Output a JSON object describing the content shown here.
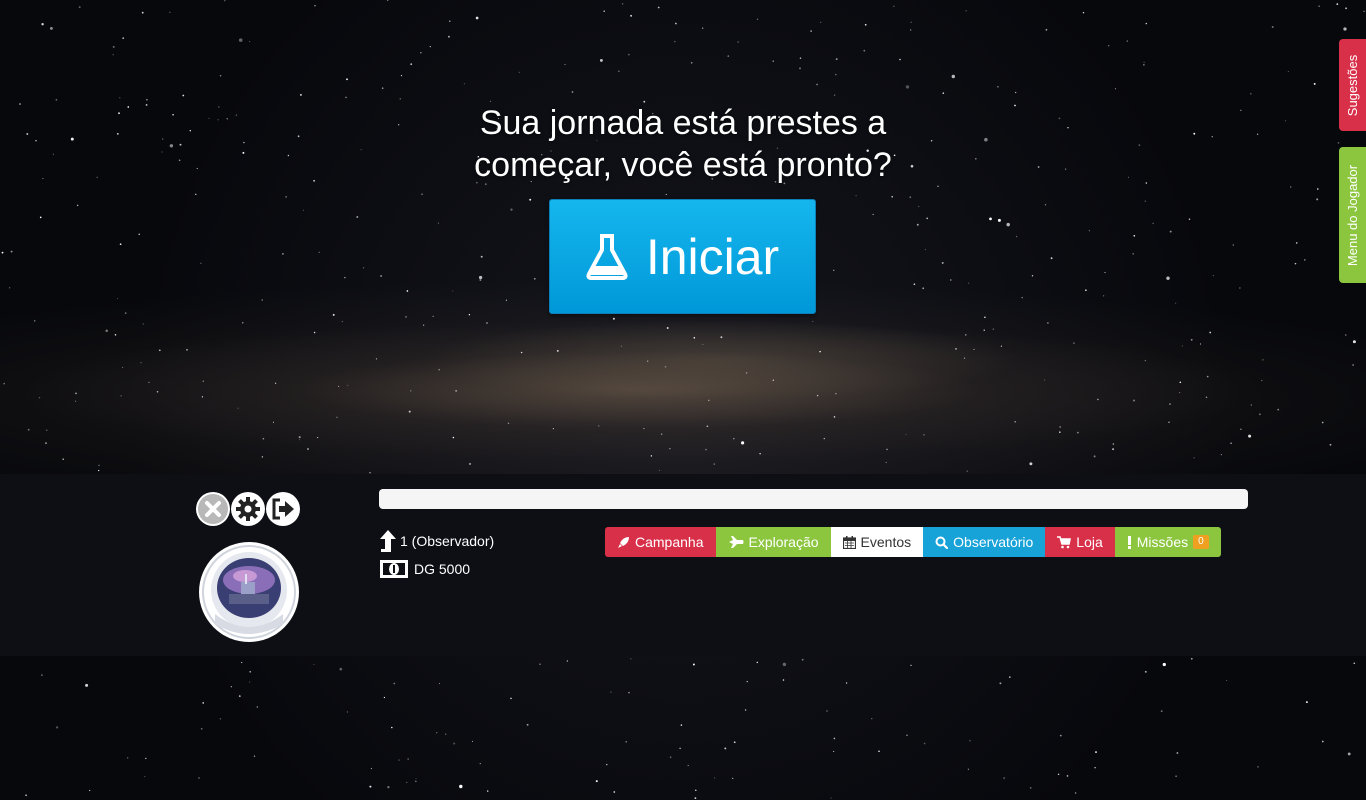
{
  "hero": {
    "headline_line1": "Sua jornada está prestes a",
    "headline_line2": "começar, você está pronto?",
    "start_label": "Iniciar"
  },
  "side_tabs": {
    "suggestions": "Sugestões",
    "player_menu": "Menu do Jogador"
  },
  "player": {
    "level": "1 (Observador)",
    "currency": "DG 5000",
    "progress": 0
  },
  "nav": {
    "campaign": "Campanha",
    "exploration": "Exploração",
    "events": "Eventos",
    "observatory": "Observatório",
    "shop": "Loja",
    "missions": "Missões",
    "missions_badge": "0"
  },
  "colors": {
    "red": "#d9304a",
    "green": "#8cc63f",
    "blue": "#17a2d8",
    "start_button": "#0aa6e4",
    "badge": "#f0a020"
  },
  "icons": {
    "start": "flask-icon",
    "close": "close-icon",
    "settings": "gear-icon",
    "logout": "logout-icon",
    "level": "arrow-up-icon",
    "currency": "money-icon",
    "campaign": "rocket-icon",
    "exploration": "plane-icon",
    "events": "calendar-icon",
    "observatory": "search-icon",
    "shop": "cart-icon",
    "missions": "exclamation-icon"
  }
}
